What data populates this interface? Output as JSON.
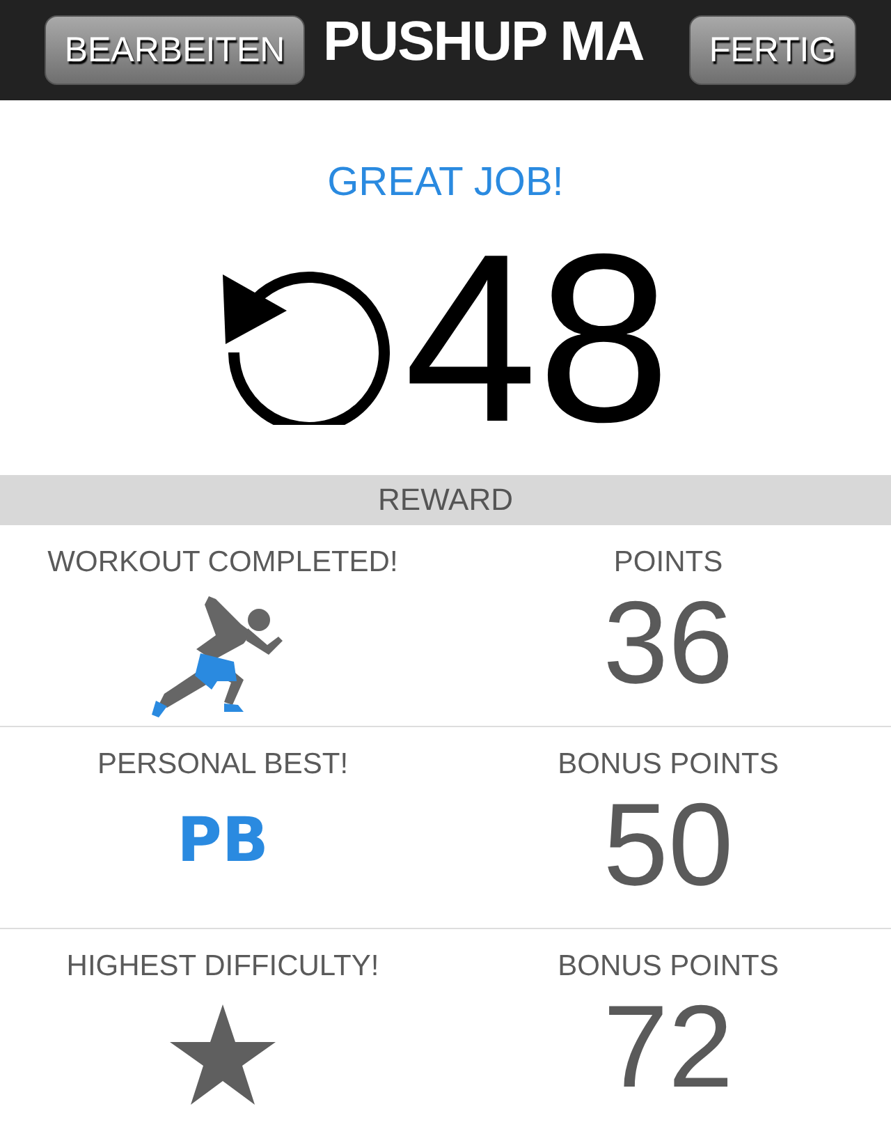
{
  "header": {
    "left_button": "BEARBEITEN",
    "title": "PUSHUP MA",
    "right_button": "FERTIG"
  },
  "result": {
    "message": "GREAT JOB!",
    "count": "48"
  },
  "reward": {
    "title": "REWARD",
    "rows": [
      {
        "kind": "runner",
        "label": "WORKOUT COMPLETED!",
        "points_label": "POINTS",
        "points": "36"
      },
      {
        "kind": "pb",
        "label": "PERSONAL BEST!",
        "badge": "PB",
        "points_label": "BONUS POINTS",
        "points": "50"
      },
      {
        "kind": "star",
        "label": "HIGHEST DIFFICULTY!",
        "points_label": "BONUS POINTS",
        "points": "72"
      }
    ]
  }
}
